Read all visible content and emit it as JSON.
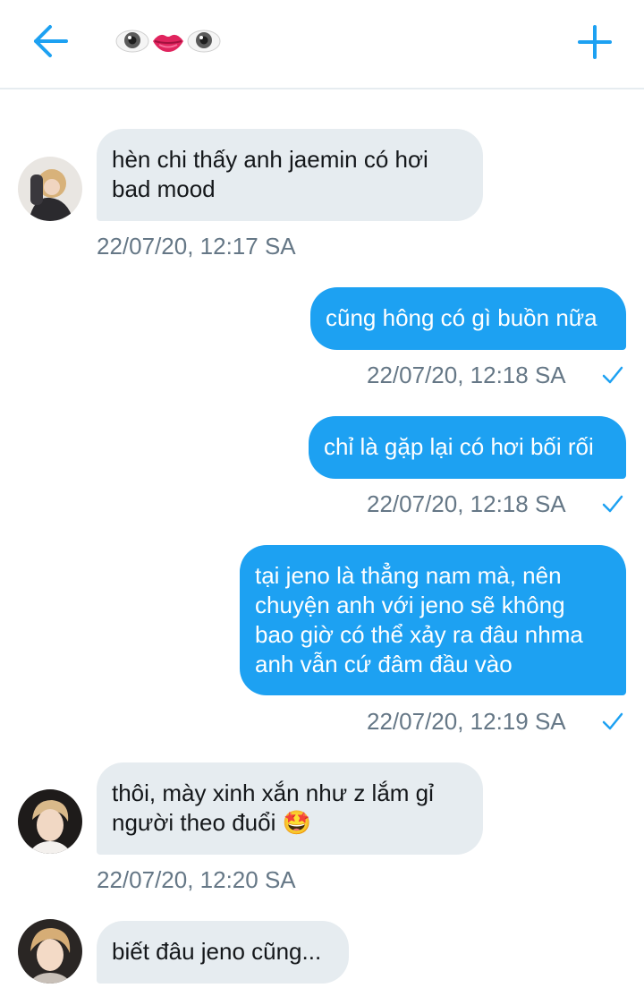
{
  "header": {
    "back_icon": "arrow-left-icon",
    "title_icons": [
      "eye-emoji-icon",
      "lips-emoji-icon",
      "eye-emoji-icon"
    ],
    "add_icon": "plus-icon",
    "accent_color": "#1da1f2"
  },
  "messages": [
    {
      "direction": "in",
      "text": "hèn chi thấy anh jaemin có hơi\nbad mood",
      "timestamp": "22/07/20, 12:17 SA",
      "avatar": "avatar-1"
    },
    {
      "direction": "out",
      "text": "cũng hông có gì buồn nữa",
      "timestamp": "22/07/20, 12:18 SA",
      "read": true
    },
    {
      "direction": "out",
      "text": "chỉ là gặp lại có hơi bối rối",
      "timestamp": "22/07/20, 12:18 SA",
      "read": true
    },
    {
      "direction": "out",
      "text": "tại jeno là thẳng nam mà, nên\nchuyện anh với jeno sẽ không\nbao giờ có thể xảy ra đâu nhma\nanh vẫn cứ đâm đầu vào",
      "timestamp": "22/07/20, 12:19 SA",
      "read": true
    },
    {
      "direction": "in",
      "text": "thôi, mày xinh xắn như z lắm gỉ\nngười theo đuổi 🤩",
      "timestamp": "22/07/20, 12:20 SA",
      "avatar": "avatar-2"
    },
    {
      "direction": "in",
      "text": "biết đâu jeno cũng...",
      "timestamp": "",
      "avatar": "avatar-3"
    }
  ],
  "colors": {
    "incoming_bubble": "#e6ecf0",
    "outgoing_bubble": "#1da1f2",
    "timestamp": "#657786",
    "check": "#1da1f2"
  }
}
